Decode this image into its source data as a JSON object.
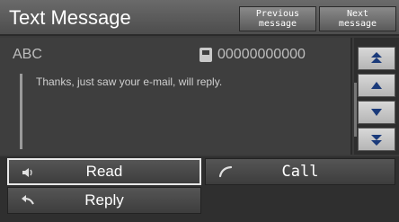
{
  "header": {
    "title": "Text Message",
    "prev_label_1": "Previous",
    "prev_label_2": "message",
    "next_label_1": "Next",
    "next_label_2": "message"
  },
  "message": {
    "sender": "ABC",
    "phone": "00000000000",
    "body": "Thanks, just saw your e-mail, will reply."
  },
  "actions": {
    "read": "Read",
    "call": "Call",
    "reply": "Reply"
  },
  "icons": {
    "speaker": "speaker-icon",
    "phone_handset": "phone-handset-icon",
    "reply_arrow": "reply-arrow-icon",
    "phone_card": "phone-card-icon",
    "scroll_top": "double-up-arrow-icon",
    "scroll_up": "up-arrow-icon",
    "scroll_down": "down-arrow-icon",
    "scroll_bottom": "double-down-arrow-icon"
  },
  "colors": {
    "scroll_arrow": "#1a3a7a",
    "selected_border": "#e8e8e8"
  }
}
